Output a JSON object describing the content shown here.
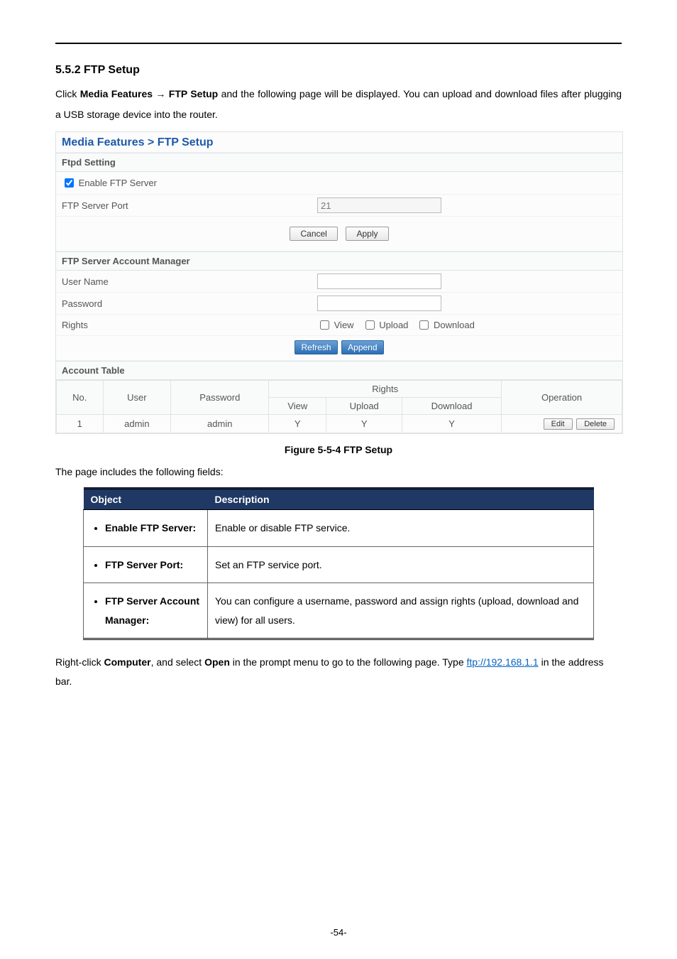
{
  "section": {
    "heading": "5.5.2  FTP Setup",
    "intro_pre": "Click ",
    "intro_bold1": "Media Features",
    "intro_arrow": " → ",
    "intro_bold2": "FTP Setup",
    "intro_post": " and the following page will be displayed. You can upload and download files after plugging a USB storage device into the router."
  },
  "ui": {
    "breadcrumb": "Media Features > FTP Setup",
    "ftpd_setting_label": "Ftpd Setting",
    "enable_ftp_label": "Enable FTP Server",
    "enable_ftp_checked": true,
    "port_label": "FTP Server Port",
    "port_value": "21",
    "cancel": "Cancel",
    "apply": "Apply",
    "account_mgr_label": "FTP Server Account Manager",
    "username_label": "User Name",
    "password_label": "Password",
    "rights_label": "Rights",
    "rights": {
      "view": "View",
      "upload": "Upload",
      "download": "Download"
    },
    "refresh": "Refresh",
    "append": "Append",
    "account_table_label": "Account Table",
    "headers": {
      "no": "No.",
      "user": "User",
      "password": "Password",
      "rights": "Rights",
      "view": "View",
      "upload": "Upload",
      "download": "Download",
      "operation": "Operation"
    },
    "rows": [
      {
        "no": "1",
        "user": "admin",
        "password": "admin",
        "view": "Y",
        "upload": "Y",
        "download": "Y"
      }
    ],
    "edit": "Edit",
    "delete": "Delete"
  },
  "figure_caption": "Figure 5-5-4 FTP Setup",
  "intro2": "The page includes the following fields:",
  "objdesc": {
    "h1": "Object",
    "h2": "Description",
    "rows": [
      {
        "obj": "Enable FTP Server:",
        "desc": "Enable or disable FTP service."
      },
      {
        "obj": "FTP Server Port:",
        "desc": "Set an FTP service port."
      },
      {
        "obj": "FTP Server Account Manager:",
        "desc": "You can configure a username, password and assign rights (upload, download and view) for all users."
      }
    ]
  },
  "post": {
    "pre": "Right-click ",
    "b1": "Computer",
    "mid1": ", and select ",
    "b2": "Open",
    "mid2": " in the prompt menu to go to the following page. Type ",
    "link_text": "ftp://192.168.1.1",
    "post": " in the address bar."
  },
  "page_number": "-54-"
}
